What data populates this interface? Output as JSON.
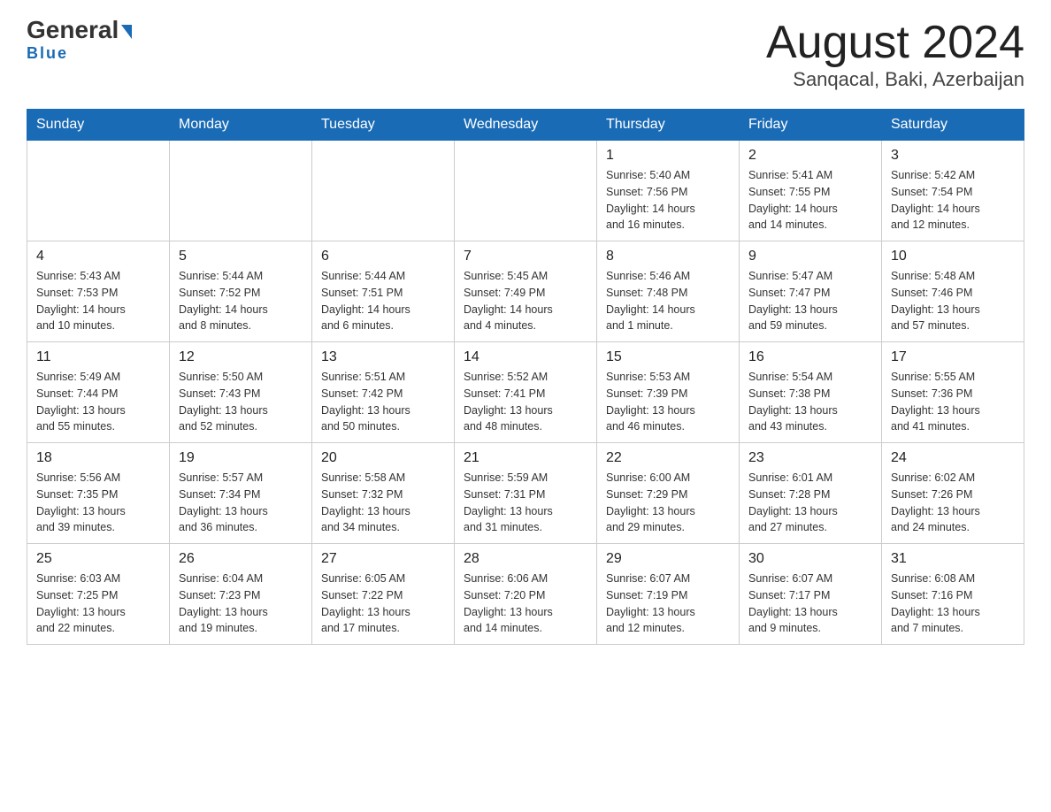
{
  "header": {
    "logo_general": "General",
    "logo_blue": "Blue",
    "month_title": "August 2024",
    "location": "Sanqacal, Baki, Azerbaijan"
  },
  "weekdays": [
    "Sunday",
    "Monday",
    "Tuesday",
    "Wednesday",
    "Thursday",
    "Friday",
    "Saturday"
  ],
  "weeks": [
    [
      {
        "day": "",
        "info": ""
      },
      {
        "day": "",
        "info": ""
      },
      {
        "day": "",
        "info": ""
      },
      {
        "day": "",
        "info": ""
      },
      {
        "day": "1",
        "info": "Sunrise: 5:40 AM\nSunset: 7:56 PM\nDaylight: 14 hours\nand 16 minutes."
      },
      {
        "day": "2",
        "info": "Sunrise: 5:41 AM\nSunset: 7:55 PM\nDaylight: 14 hours\nand 14 minutes."
      },
      {
        "day": "3",
        "info": "Sunrise: 5:42 AM\nSunset: 7:54 PM\nDaylight: 14 hours\nand 12 minutes."
      }
    ],
    [
      {
        "day": "4",
        "info": "Sunrise: 5:43 AM\nSunset: 7:53 PM\nDaylight: 14 hours\nand 10 minutes."
      },
      {
        "day": "5",
        "info": "Sunrise: 5:44 AM\nSunset: 7:52 PM\nDaylight: 14 hours\nand 8 minutes."
      },
      {
        "day": "6",
        "info": "Sunrise: 5:44 AM\nSunset: 7:51 PM\nDaylight: 14 hours\nand 6 minutes."
      },
      {
        "day": "7",
        "info": "Sunrise: 5:45 AM\nSunset: 7:49 PM\nDaylight: 14 hours\nand 4 minutes."
      },
      {
        "day": "8",
        "info": "Sunrise: 5:46 AM\nSunset: 7:48 PM\nDaylight: 14 hours\nand 1 minute."
      },
      {
        "day": "9",
        "info": "Sunrise: 5:47 AM\nSunset: 7:47 PM\nDaylight: 13 hours\nand 59 minutes."
      },
      {
        "day": "10",
        "info": "Sunrise: 5:48 AM\nSunset: 7:46 PM\nDaylight: 13 hours\nand 57 minutes."
      }
    ],
    [
      {
        "day": "11",
        "info": "Sunrise: 5:49 AM\nSunset: 7:44 PM\nDaylight: 13 hours\nand 55 minutes."
      },
      {
        "day": "12",
        "info": "Sunrise: 5:50 AM\nSunset: 7:43 PM\nDaylight: 13 hours\nand 52 minutes."
      },
      {
        "day": "13",
        "info": "Sunrise: 5:51 AM\nSunset: 7:42 PM\nDaylight: 13 hours\nand 50 minutes."
      },
      {
        "day": "14",
        "info": "Sunrise: 5:52 AM\nSunset: 7:41 PM\nDaylight: 13 hours\nand 48 minutes."
      },
      {
        "day": "15",
        "info": "Sunrise: 5:53 AM\nSunset: 7:39 PM\nDaylight: 13 hours\nand 46 minutes."
      },
      {
        "day": "16",
        "info": "Sunrise: 5:54 AM\nSunset: 7:38 PM\nDaylight: 13 hours\nand 43 minutes."
      },
      {
        "day": "17",
        "info": "Sunrise: 5:55 AM\nSunset: 7:36 PM\nDaylight: 13 hours\nand 41 minutes."
      }
    ],
    [
      {
        "day": "18",
        "info": "Sunrise: 5:56 AM\nSunset: 7:35 PM\nDaylight: 13 hours\nand 39 minutes."
      },
      {
        "day": "19",
        "info": "Sunrise: 5:57 AM\nSunset: 7:34 PM\nDaylight: 13 hours\nand 36 minutes."
      },
      {
        "day": "20",
        "info": "Sunrise: 5:58 AM\nSunset: 7:32 PM\nDaylight: 13 hours\nand 34 minutes."
      },
      {
        "day": "21",
        "info": "Sunrise: 5:59 AM\nSunset: 7:31 PM\nDaylight: 13 hours\nand 31 minutes."
      },
      {
        "day": "22",
        "info": "Sunrise: 6:00 AM\nSunset: 7:29 PM\nDaylight: 13 hours\nand 29 minutes."
      },
      {
        "day": "23",
        "info": "Sunrise: 6:01 AM\nSunset: 7:28 PM\nDaylight: 13 hours\nand 27 minutes."
      },
      {
        "day": "24",
        "info": "Sunrise: 6:02 AM\nSunset: 7:26 PM\nDaylight: 13 hours\nand 24 minutes."
      }
    ],
    [
      {
        "day": "25",
        "info": "Sunrise: 6:03 AM\nSunset: 7:25 PM\nDaylight: 13 hours\nand 22 minutes."
      },
      {
        "day": "26",
        "info": "Sunrise: 6:04 AM\nSunset: 7:23 PM\nDaylight: 13 hours\nand 19 minutes."
      },
      {
        "day": "27",
        "info": "Sunrise: 6:05 AM\nSunset: 7:22 PM\nDaylight: 13 hours\nand 17 minutes."
      },
      {
        "day": "28",
        "info": "Sunrise: 6:06 AM\nSunset: 7:20 PM\nDaylight: 13 hours\nand 14 minutes."
      },
      {
        "day": "29",
        "info": "Sunrise: 6:07 AM\nSunset: 7:19 PM\nDaylight: 13 hours\nand 12 minutes."
      },
      {
        "day": "30",
        "info": "Sunrise: 6:07 AM\nSunset: 7:17 PM\nDaylight: 13 hours\nand 9 minutes."
      },
      {
        "day": "31",
        "info": "Sunrise: 6:08 AM\nSunset: 7:16 PM\nDaylight: 13 hours\nand 7 minutes."
      }
    ]
  ]
}
